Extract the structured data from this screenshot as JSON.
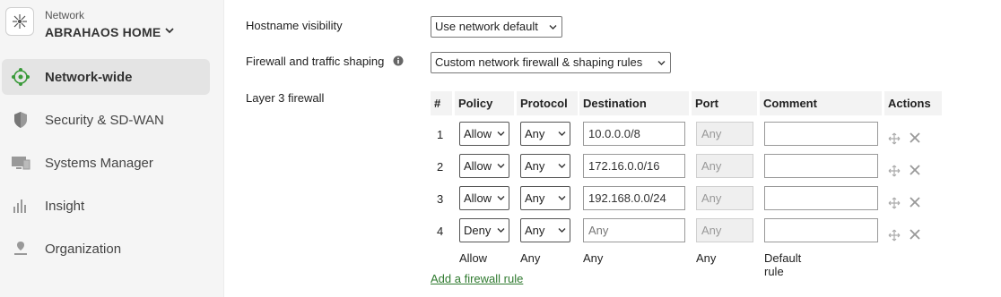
{
  "sidebar": {
    "network_label": "Network",
    "network_name": "ABRAHAOS HOME",
    "items": [
      {
        "label": "Network-wide"
      },
      {
        "label": "Security & SD-WAN"
      },
      {
        "label": "Systems Manager"
      },
      {
        "label": "Insight"
      },
      {
        "label": "Organization"
      }
    ]
  },
  "settings": {
    "hostname_label": "Hostname visibility",
    "hostname_value": "Use network default",
    "firewall_label": "Firewall and traffic shaping",
    "firewall_value": "Custom network firewall & shaping rules",
    "l3_label": "Layer 3 firewall"
  },
  "table": {
    "headers": [
      "#",
      "Policy",
      "Protocol",
      "Destination",
      "Port",
      "Comment",
      "Actions"
    ],
    "rows": [
      {
        "num": "1",
        "policy": "Allow",
        "protocol": "Any",
        "destination": "10.0.0.0/8",
        "port": "Any",
        "comment": ""
      },
      {
        "num": "2",
        "policy": "Allow",
        "protocol": "Any",
        "destination": "172.16.0.0/16",
        "port": "Any",
        "comment": ""
      },
      {
        "num": "3",
        "policy": "Allow",
        "protocol": "Any",
        "destination": "192.168.0.0/24",
        "port": "Any",
        "comment": ""
      },
      {
        "num": "4",
        "policy": "Deny",
        "protocol": "Any",
        "destination": "Any",
        "port": "Any",
        "comment": ""
      }
    ],
    "default_row": {
      "policy": "Allow",
      "protocol": "Any",
      "destination": "Any",
      "port": "Any",
      "comment": "Default rule"
    },
    "add_link": "Add a firewall rule"
  },
  "colors": {
    "link": "#2f7a2f",
    "active_nav": "#e4e4e4",
    "brand_green": "#2ea043"
  }
}
